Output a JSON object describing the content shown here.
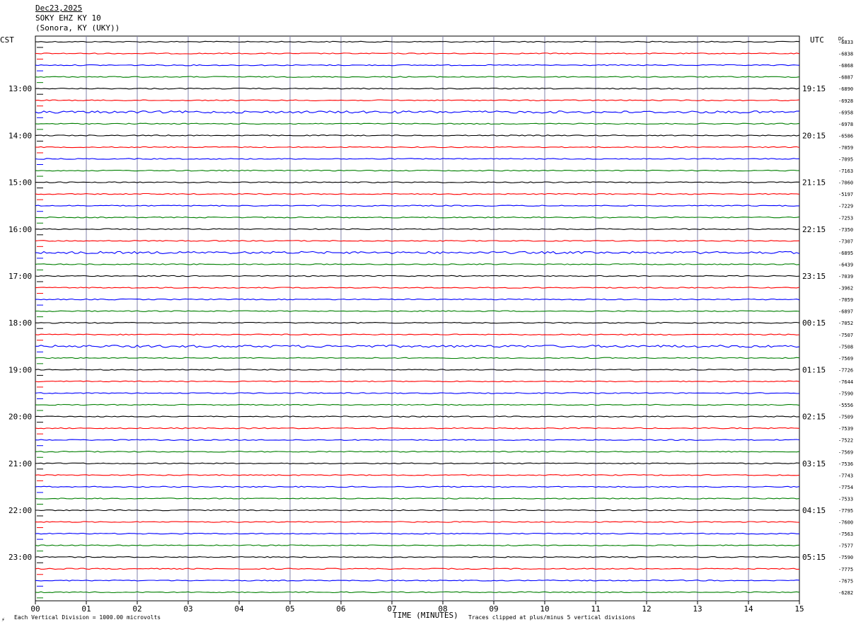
{
  "header": {
    "date": "Dec23,2025",
    "station": "SOKY EHZ KY 10",
    "location": "(Sonora, KY (UKY))"
  },
  "axis_labels": {
    "left": "CST",
    "right": "UTC",
    "dc": "DC"
  },
  "footer": {
    "left_mark": "⚡",
    "scale_note": "Each Vertical Division = 1000.00 microvolts",
    "clip_note": "Traces clipped at plus/minus 5 vertical divisions"
  },
  "chart_data": {
    "type": "line",
    "title": "",
    "xlabel": "TIME (MINUTES)",
    "ylabel": "",
    "x_ticks": [
      "00",
      "01",
      "02",
      "03",
      "04",
      "05",
      "06",
      "07",
      "08",
      "09",
      "10",
      "11",
      "12",
      "13",
      "14",
      "15"
    ],
    "xlim": [
      0,
      15
    ],
    "grid": true,
    "left_hour_labels": [
      "13:00",
      "14:00",
      "15:00",
      "16:00",
      "17:00",
      "18:00",
      "19:00",
      "20:00",
      "21:00",
      "22:00",
      "23:00"
    ],
    "right_hour_labels": [
      "19:15",
      "20:15",
      "21:15",
      "22:15",
      "23:15",
      "00:15",
      "01:15",
      "02:15",
      "03:15",
      "04:15",
      "05:15"
    ],
    "trace_colors": [
      "#000000",
      "#ff0000",
      "#0000ff",
      "#007f00"
    ],
    "dc_offsets": [
      "-6833",
      "-6838",
      "-6868",
      "-6887",
      "-6890",
      "-6928",
      "-6958",
      "-6978",
      "-6586",
      "-7059",
      "-7095",
      "-7163",
      "-7060",
      "-5197",
      "-7229",
      "-7253",
      "-7350",
      "-7307",
      "-6895",
      "-6439",
      "-7039",
      "-3962",
      "-7059",
      "-6897",
      "-7052",
      "-7507",
      "-7508",
      "-7569",
      "-7726",
      "-7644",
      "-7590",
      "-5556",
      "-7509",
      "-7539",
      "-7522",
      "-7569",
      "-7536",
      "-7743",
      "-7754",
      "-7533",
      "-7795",
      "-7600",
      "-7563",
      "-7577",
      "-7590",
      "-7775",
      "-7675",
      "-6282"
    ],
    "trace_count": 48
  }
}
